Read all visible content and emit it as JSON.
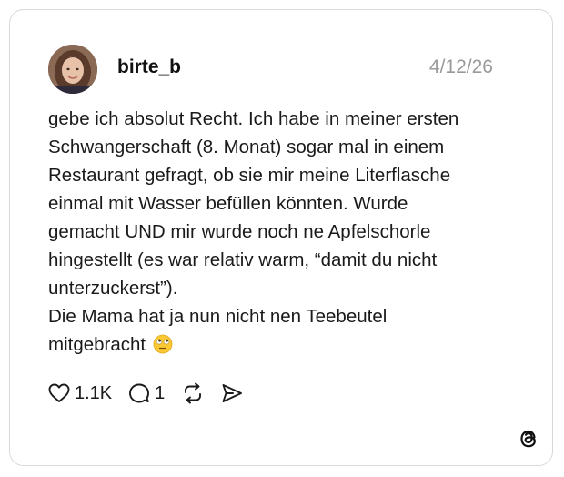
{
  "post": {
    "username": "birte_b",
    "date": "4/12/26",
    "text_lines": [
      "gebe ich absolut Recht. Ich habe in meiner ersten",
      "Schwangerschaft (8. Monat) sogar mal in einem",
      "Restaurant gefragt, ob sie mir meine Literflasche",
      "einmal mit Wasser befüllen könnten. Wurde",
      "gemacht UND mir wurde noch ne Apfelschorle",
      "hingestellt (es war relativ warm, “damit du nicht",
      "unterzuckerst”).",
      "Die Mama hat ja nun nicht nen Teebeutel",
      "mitgebracht"
    ],
    "emoji": "eye-roll-emoji"
  },
  "actions": {
    "like_count": "1.1K",
    "reply_count": "1",
    "like_icon": "heart-icon",
    "reply_icon": "speech-bubble-icon",
    "repost_icon": "repost-icon",
    "share_icon": "send-icon"
  },
  "brand": {
    "logo": "threads-logo-icon"
  },
  "colors": {
    "card_border": "#d9d9d9",
    "date_text": "#9a9a9a",
    "text": "#1a1a1a"
  }
}
